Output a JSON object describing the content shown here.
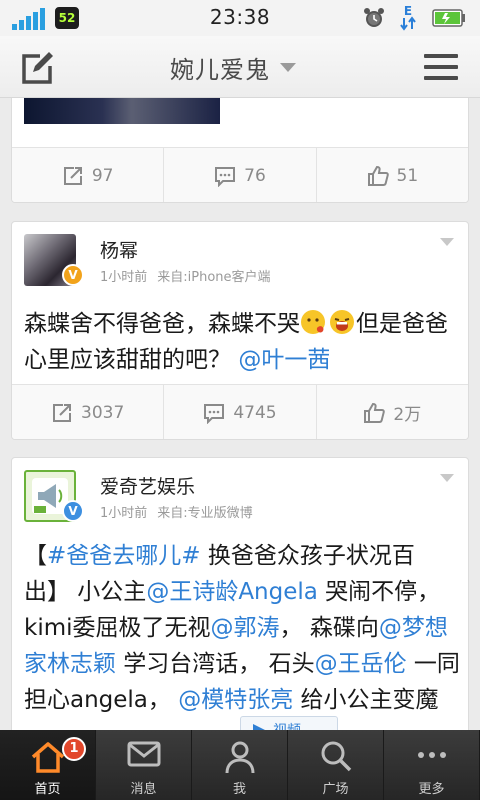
{
  "status_bar": {
    "time": "23:38",
    "battery_level": "52"
  },
  "title_bar": {
    "title": "婉儿爱鬼"
  },
  "posts": [
    {
      "actions": {
        "repost": "97",
        "comment": "76",
        "like": "51"
      }
    },
    {
      "author": "杨幂",
      "time": "1小时前",
      "source": "来自:iPhone客户端",
      "text_main": "森蝶舍不得爸爸，森蝶不哭",
      "text_tail": "但是爸爸心里应该甜甜的吧？",
      "mention": "@叶一茜",
      "actions": {
        "repost": "3037",
        "comment": "4745",
        "like": "2万"
      }
    },
    {
      "author": "爱奇艺娱乐",
      "time": "1小时前",
      "source": "来自:专业版微博",
      "open_bracket": "【",
      "hashtag": "#爸爸去哪儿#",
      "text_1": " 换爸爸众孩子状况百出】 小公主",
      "mention_1": "@王诗龄Angela",
      "text_2": " 哭闹不停，kimi委屈极了无视",
      "mention_2": "@郭涛",
      "text_3": "， 森碟向",
      "mention_3": "@梦想家林志颖",
      "text_4": " 学习台湾话， 石头",
      "mention_4": "@王岳伦",
      "text_5": " 一同担心angela， ",
      "mention_5": "@模特张亮",
      "text_6": " 给小公主变魔术",
      "video_label": "视频"
    }
  ],
  "bottom_nav": [
    {
      "label": "首页",
      "icon": "home-icon",
      "badge": "1"
    },
    {
      "label": "消息",
      "icon": "mail-icon"
    },
    {
      "label": "我",
      "icon": "person-icon"
    },
    {
      "label": "广场",
      "icon": "search-icon"
    },
    {
      "label": "更多",
      "icon": "more-icon"
    }
  ],
  "colors": {
    "accent": "#2f7fd4",
    "badge": "#e2472b",
    "verified_gold": "#f2a31b",
    "verified_blue": "#3d8fe0"
  }
}
